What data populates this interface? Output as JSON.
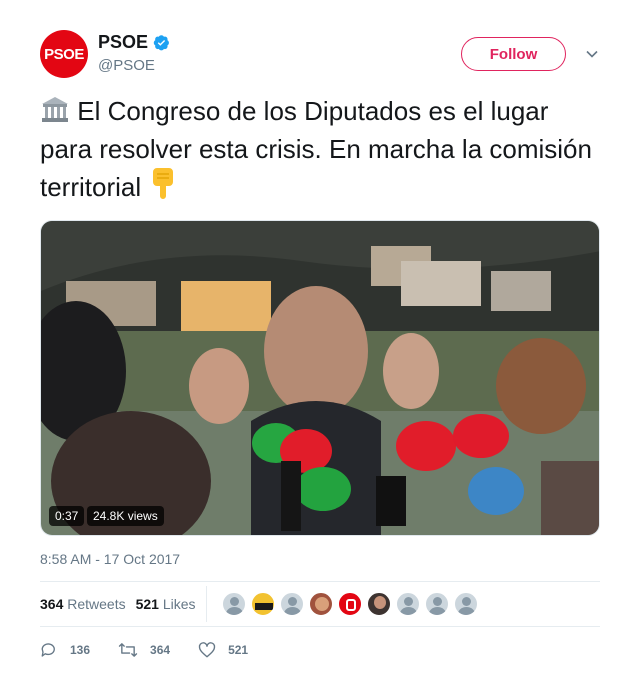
{
  "author": {
    "avatar_text": "PSOE",
    "display_name": "PSOE",
    "handle": "@PSOE",
    "verified": true,
    "brand_color": "#e30613"
  },
  "follow_label": "Follow",
  "tweet": {
    "text": "El Congreso de los Diputados es el lugar para resolver esta crisis. En marcha la comisión territorial",
    "leading_emoji": "🏛️",
    "trailing_emoji": "👇"
  },
  "video": {
    "duration": "0:37",
    "views": "24.8K views"
  },
  "timestamp": "8:58 AM - 17 Oct 2017",
  "stats": {
    "retweets_count": "364",
    "retweets_label": "Retweets",
    "likes_count": "521",
    "likes_label": "Likes"
  },
  "actions": {
    "reply_count": "136",
    "retweet_count": "364",
    "like_count": "521"
  },
  "colors": {
    "accent": "#e0245e",
    "muted": "#657786",
    "verified": "#1da1f2"
  }
}
